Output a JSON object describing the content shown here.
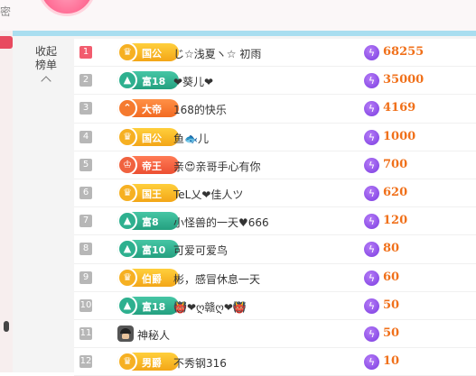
{
  "header": {
    "top_left_text": "密"
  },
  "sidebar": {
    "collapse_label_line1": "收起",
    "collapse_label_line2": "榜单"
  },
  "ranking": [
    {
      "rank": "1",
      "badge": "国公",
      "badge_style": "gold",
      "name": "じ☆浅夏ヽ☆ 初雨",
      "score": "68255"
    },
    {
      "rank": "2",
      "badge": "富18",
      "badge_style": "teal",
      "name": "❤葵儿❤",
      "score": "35000"
    },
    {
      "rank": "3",
      "badge": "大帝",
      "badge_style": "orange",
      "name": "168的快乐",
      "score": "4169"
    },
    {
      "rank": "4",
      "badge": "国公",
      "badge_style": "gold",
      "name": "鱼🐟儿",
      "score": "1000"
    },
    {
      "rank": "5",
      "badge": "帝王",
      "badge_style": "red",
      "name": "亲😍亲哥手心有你",
      "score": "700"
    },
    {
      "rank": "6",
      "badge": "国王",
      "badge_style": "gold",
      "name": "TeL乂❤佳人ツ",
      "score": "620"
    },
    {
      "rank": "7",
      "badge": "富8",
      "badge_style": "teal",
      "name": "小怪兽的一天♥666",
      "score": "120"
    },
    {
      "rank": "8",
      "badge": "富10",
      "badge_style": "teal",
      "name": "可爱可爱鸟",
      "score": "80"
    },
    {
      "rank": "9",
      "badge": "伯爵",
      "badge_style": "gold",
      "name": "彬，感冒休息一天",
      "score": "60"
    },
    {
      "rank": "10",
      "badge": "富18",
      "badge_style": "teal",
      "name": "👹❤ღ赣ღ❤👹",
      "score": "50"
    },
    {
      "rank": "11",
      "badge": "",
      "badge_style": "none",
      "name": "神秘人",
      "score": "50"
    },
    {
      "rank": "12",
      "badge": "男爵",
      "badge_style": "gold",
      "name": "不秀钢316",
      "score": "10"
    }
  ],
  "icons": {
    "coin": "lightning-coin-icon",
    "badge_crown": "crown-icon",
    "mystery": "mystery-person-icon"
  },
  "colors": {
    "accent_blue": "#a9def0",
    "score_orange": "#f0701a",
    "rank_top": "#f25c6e",
    "coin_purple": "#7a3ce0"
  }
}
